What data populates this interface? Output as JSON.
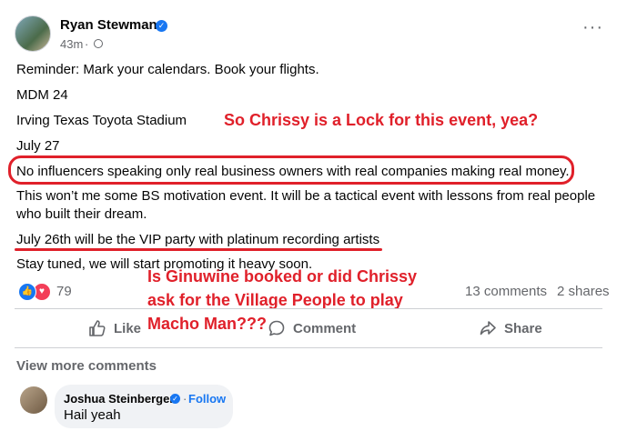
{
  "post": {
    "author": "Ryan Stewman",
    "time": "43m",
    "more_icon": "···",
    "close_icon": "✕",
    "lines": [
      "Reminder: Mark your calendars. Book your flights.",
      "MDM 24",
      "Irving Texas Toyota Stadium",
      "July 27",
      "No influencers speaking only real business owners with real companies making real money.",
      "This won’t me some BS motivation event. It will be a tactical event with lessons from real people",
      "who built their dream.",
      "July 26th will be the VIP party with platinum recording artists",
      "Stay tuned, we will start promoting it heavy soon."
    ]
  },
  "annotations": {
    "note1": "So Chrissy is a Lock for this event, yea?",
    "note2_line1": "Is Ginuwine booked or did Chrissy",
    "note2_line2": "ask for the Village People to play",
    "note2_line3": "Macho Man???"
  },
  "stats": {
    "reaction_count": "79",
    "comments": "13 comments",
    "shares": "2 shares"
  },
  "actions": {
    "like": "Like",
    "comment": "Comment",
    "share": "Share"
  },
  "comments_section": {
    "view_more": "View more comments",
    "comment": {
      "author": "Joshua Steinberger",
      "follow": "Follow",
      "separator": "·",
      "text": "Hail yeah"
    }
  },
  "colors": {
    "annotation_red": "#e0202a",
    "facebook_blue": "#1877f2",
    "meta_gray": "#65676b"
  }
}
